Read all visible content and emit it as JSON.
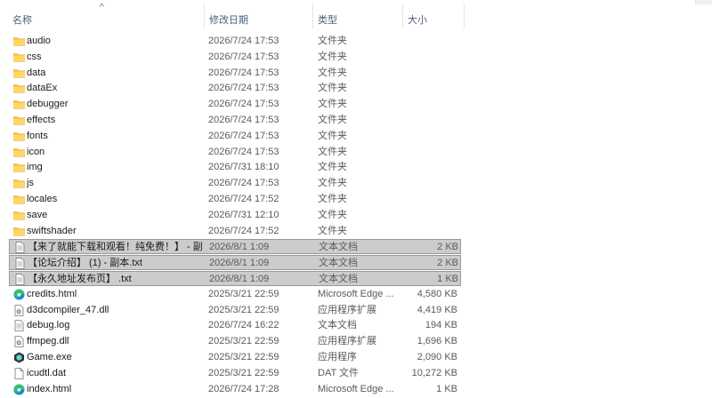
{
  "columns": {
    "name": "名称",
    "date": "修改日期",
    "type": "类型",
    "size": "大小"
  },
  "sort_icon": "chevron-up-icon",
  "colors": {
    "folder": "#f5c542",
    "selection": "#cccccc",
    "edge": "#1a86d4",
    "header_text": "#4c607a"
  },
  "files": [
    {
      "name": "audio",
      "date": "2026/7/24 17:53",
      "type": "文件夹",
      "size": "",
      "icon": "folder-icon",
      "selected": false
    },
    {
      "name": "css",
      "date": "2026/7/24 17:53",
      "type": "文件夹",
      "size": "",
      "icon": "folder-icon",
      "selected": false
    },
    {
      "name": "data",
      "date": "2026/7/24 17:53",
      "type": "文件夹",
      "size": "",
      "icon": "folder-icon",
      "selected": false
    },
    {
      "name": "dataEx",
      "date": "2026/7/24 17:53",
      "type": "文件夹",
      "size": "",
      "icon": "folder-icon",
      "selected": false
    },
    {
      "name": "debugger",
      "date": "2026/7/24 17:53",
      "type": "文件夹",
      "size": "",
      "icon": "folder-icon",
      "selected": false
    },
    {
      "name": "effects",
      "date": "2026/7/24 17:53",
      "type": "文件夹",
      "size": "",
      "icon": "folder-icon",
      "selected": false
    },
    {
      "name": "fonts",
      "date": "2026/7/24 17:53",
      "type": "文件夹",
      "size": "",
      "icon": "folder-icon",
      "selected": false
    },
    {
      "name": "icon",
      "date": "2026/7/24 17:53",
      "type": "文件夹",
      "size": "",
      "icon": "folder-icon",
      "selected": false
    },
    {
      "name": "img",
      "date": "2026/7/31 18:10",
      "type": "文件夹",
      "size": "",
      "icon": "folder-icon",
      "selected": false
    },
    {
      "name": "js",
      "date": "2026/7/24 17:53",
      "type": "文件夹",
      "size": "",
      "icon": "folder-icon",
      "selected": false
    },
    {
      "name": "locales",
      "date": "2026/7/24 17:52",
      "type": "文件夹",
      "size": "",
      "icon": "folder-icon",
      "selected": false
    },
    {
      "name": "save",
      "date": "2026/7/31 12:10",
      "type": "文件夹",
      "size": "",
      "icon": "folder-icon",
      "selected": false
    },
    {
      "name": "swiftshader",
      "date": "2026/7/24 17:52",
      "type": "文件夹",
      "size": "",
      "icon": "folder-icon",
      "selected": false
    },
    {
      "name": "【来了就能下载和观看！纯免费！】 - 副...",
      "date": "2026/8/1 1:09",
      "type": "文本文档",
      "size": "2 KB",
      "icon": "text-file-icon",
      "selected": true
    },
    {
      "name": "【论坛介绍】 (1) - 副本.txt",
      "date": "2026/8/1 1:09",
      "type": "文本文档",
      "size": "2 KB",
      "icon": "text-file-icon",
      "selected": true
    },
    {
      "name": "【永久地址发布页】 .txt",
      "date": "2026/8/1 1:09",
      "type": "文本文档",
      "size": "1 KB",
      "icon": "text-file-icon",
      "selected": true
    },
    {
      "name": "credits.html",
      "date": "2025/3/21 22:59",
      "type": "Microsoft Edge ...",
      "size": "4,580 KB",
      "icon": "edge-icon",
      "selected": false
    },
    {
      "name": "d3dcompiler_47.dll",
      "date": "2025/3/21 22:59",
      "type": "应用程序扩展",
      "size": "4,419 KB",
      "icon": "dll-icon",
      "selected": false
    },
    {
      "name": "debug.log",
      "date": "2026/7/24 16:22",
      "type": "文本文档",
      "size": "194 KB",
      "icon": "text-file-icon",
      "selected": false
    },
    {
      "name": "ffmpeg.dll",
      "date": "2025/3/21 22:59",
      "type": "应用程序扩展",
      "size": "1,696 KB",
      "icon": "dll-icon",
      "selected": false
    },
    {
      "name": "Game.exe",
      "date": "2025/3/21 22:59",
      "type": "应用程序",
      "size": "2,090 KB",
      "icon": "game-exe-icon",
      "selected": false
    },
    {
      "name": "icudtl.dat",
      "date": "2025/3/21 22:59",
      "type": "DAT 文件",
      "size": "10,272 KB",
      "icon": "blank-file-icon",
      "selected": false
    },
    {
      "name": "index.html",
      "date": "2026/7/24 17:28",
      "type": "Microsoft Edge ...",
      "size": "1 KB",
      "icon": "edge-icon",
      "selected": false
    }
  ]
}
